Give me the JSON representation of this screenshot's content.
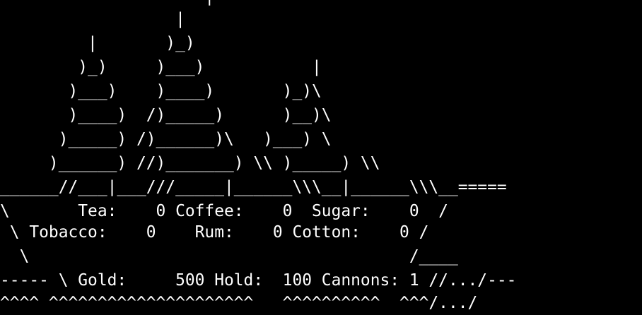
{
  "screen": {
    "background": "#000000",
    "foreground": "#ffffff",
    "lines": [
      "                     |",
      "                  |",
      "         |       )_)",
      "        )_)     )___)           |",
      "       )___)    )____)       )_)\\",
      "       )____)  /)_____)      )__)\\",
      "      )_____) /)______)\\   )___) \\",
      "     )______) //)_______) \\\\ )_____) \\\\",
      "______//___|___///_____|______\\\\\\__|______\\\\\\__=====",
      "\\       Tea:    0 Coffee:    0  Sugar:    0  /",
      " \\ Tobacco:    0    Rum:    0 Cotton:    0 /",
      "  \\                                       /____",
      "----- \\ Gold:     500 Hold:  100 Cannons: 1 //.../---",
      "^^^^ ^^^^^^^^^^^^^^^^^^^^^   ^^^^^^^^^^  ^^^/.../"
    ]
  },
  "cargo": {
    "tea": 0,
    "coffee": 0,
    "sugar": 0,
    "tobacco": 0,
    "rum": 0,
    "cotton": 0
  },
  "status": {
    "gold": 500,
    "hold": 100,
    "cannons": 1
  }
}
